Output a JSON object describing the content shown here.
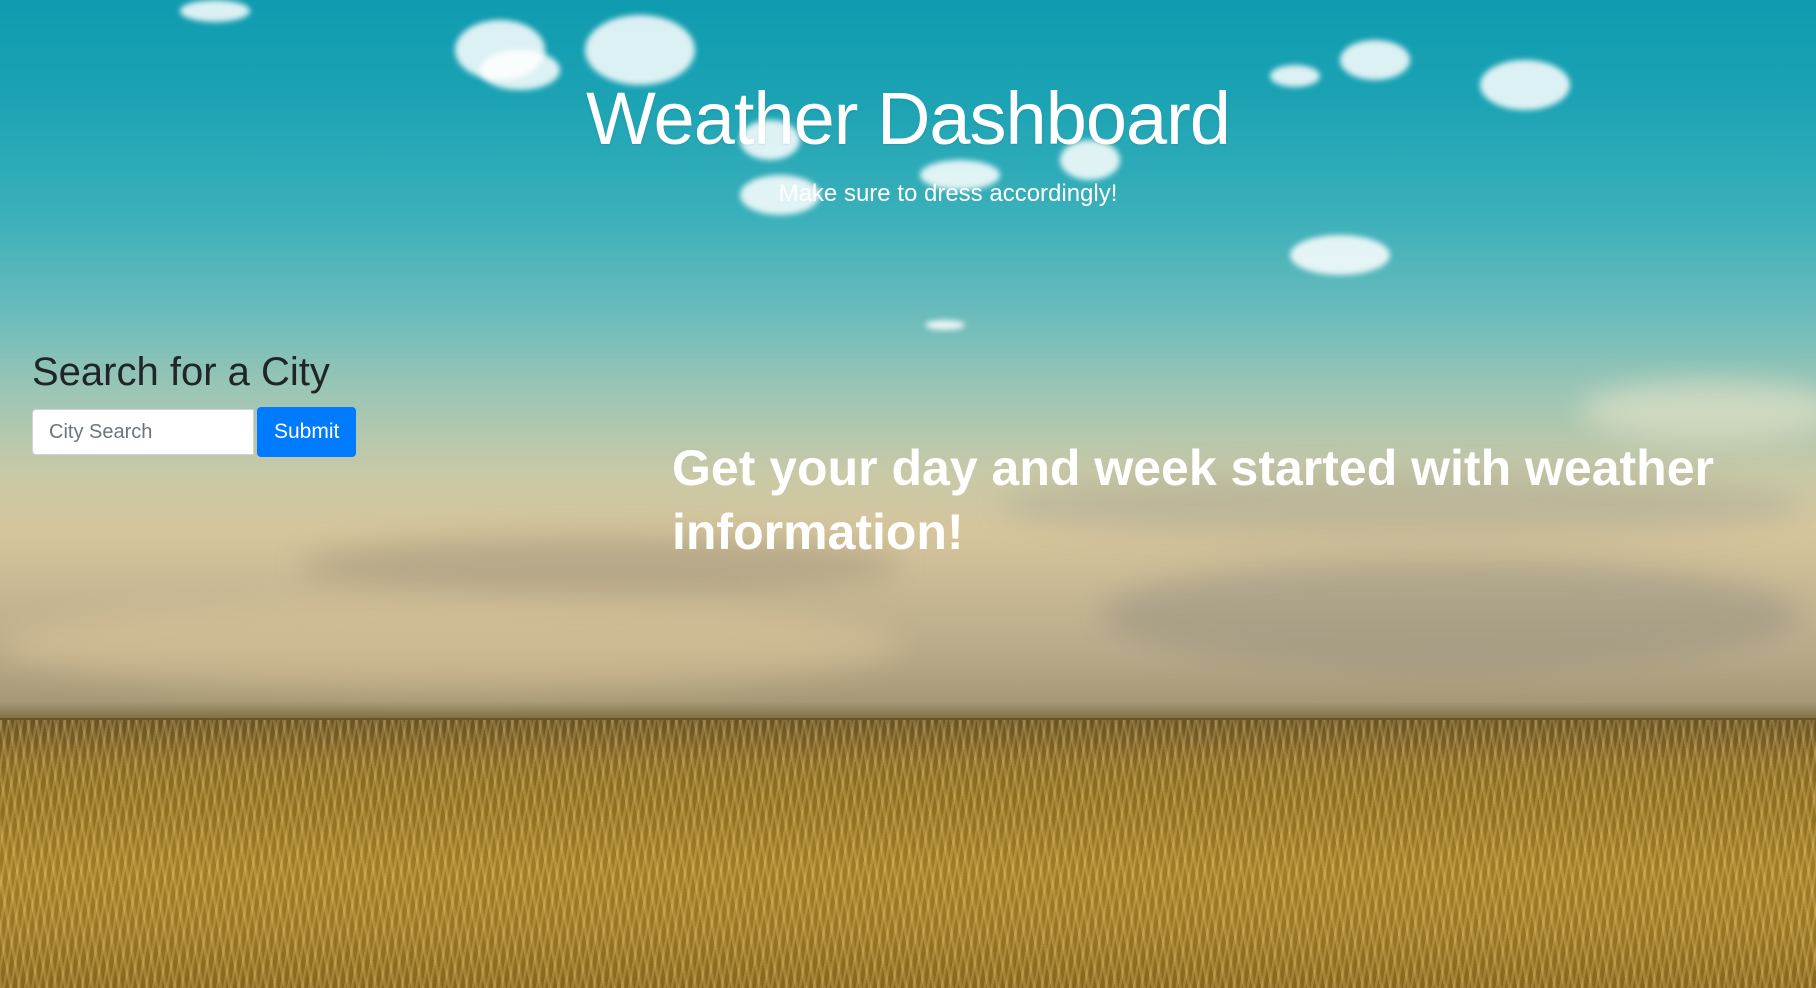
{
  "header": {
    "title": "Weather Dashboard",
    "subtitle": "Make sure to dress accordingly!"
  },
  "search": {
    "heading": "Search for a City",
    "placeholder": "City Search",
    "value": "",
    "submit_label": "Submit"
  },
  "main": {
    "tagline": "Get your day and week started with weather information!"
  },
  "colors": {
    "accent": "#007bff",
    "heading_text": "#212529",
    "light_text": "#ffffff"
  }
}
